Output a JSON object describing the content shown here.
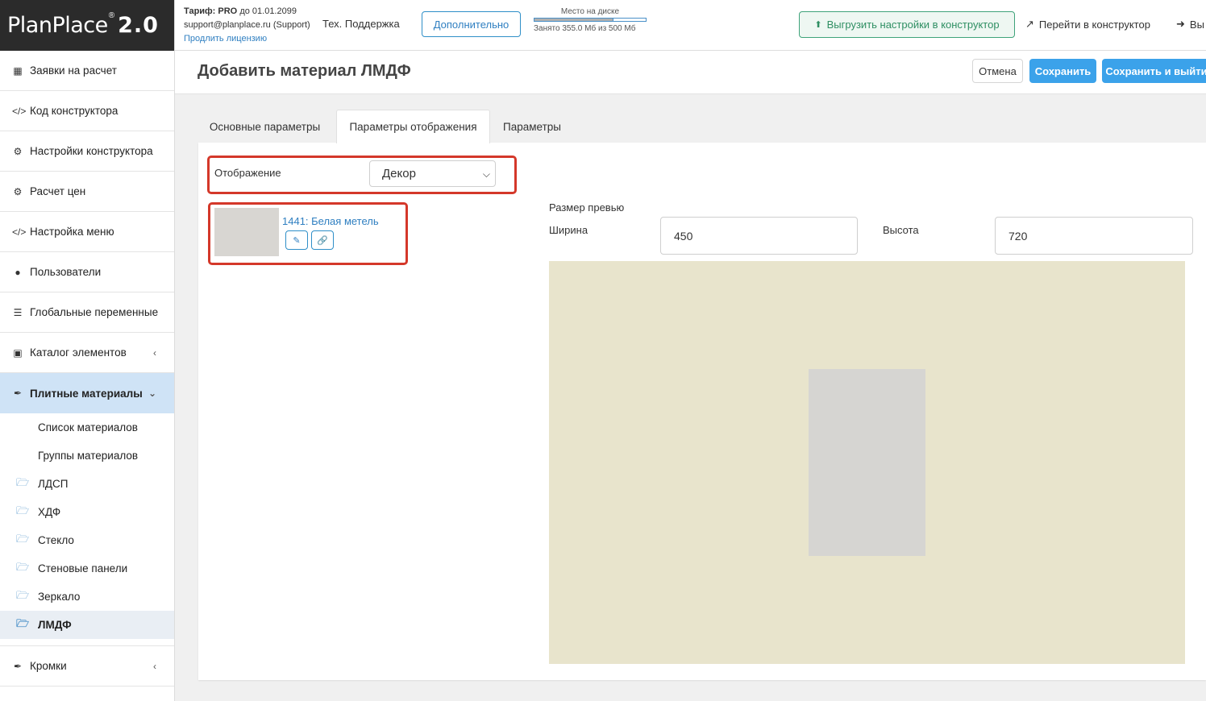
{
  "logo": {
    "brand": "PlanPlace",
    "reg": "®",
    "version": "2.0"
  },
  "license": {
    "tariff_label": "Тариф:",
    "tariff_plan": "PRO",
    "tariff_until": "до 01.01.2099",
    "email": "support@planplace.ru (Support)",
    "renew_link": "Продлить лицензию"
  },
  "topbar": {
    "support": "Тех. Поддержка",
    "more_button": "Дополнительно",
    "disk_label": "Место на диске",
    "disk_usage": "Занято 355.0 Мб из 500 Мб",
    "disk_fill_fraction": 0.71,
    "export_button": "Выгрузить настройки в конструктор",
    "go_constructor": "Перейти в конструктор",
    "exit": "Вы"
  },
  "sidebar": {
    "items": [
      {
        "label": "Заявки на расчет",
        "icon": "clipboard-icon"
      },
      {
        "label": "Код конструктора",
        "icon": "code-icon"
      },
      {
        "label": "Настройки конструктора",
        "icon": "gears-icon"
      },
      {
        "label": "Расчет цен",
        "icon": "gears-icon"
      },
      {
        "label": "Настройка меню",
        "icon": "code-icon"
      },
      {
        "label": "Пользователи",
        "icon": "user-icon"
      },
      {
        "label": "Глобальные переменные",
        "icon": "list-icon"
      },
      {
        "label": "Каталог элементов",
        "icon": "book-icon"
      },
      {
        "label": "Плитные материалы",
        "icon": "brush-icon"
      }
    ],
    "sub_items": [
      "Список материалов",
      "Группы материалов"
    ],
    "folders": [
      "ЛДСП",
      "ХДФ",
      "Стекло",
      "Стеновые панели",
      "Зеркало",
      "ЛМДФ"
    ],
    "bottom_item": "Кромки"
  },
  "page": {
    "title": "Добавить материал ЛМДФ",
    "cancel": "Отмена",
    "save": "Сохранить",
    "save_exit": "Сохранить и выйти"
  },
  "tabs": [
    "Основные параметры",
    "Параметры отображения",
    "Параметры"
  ],
  "display": {
    "label": "Отображение",
    "value": "Декор",
    "decor_link": "1441: Белая метель"
  },
  "preview": {
    "title": "Размер превью",
    "width_label": "Ширина",
    "width_value": "450",
    "height_label": "Высота",
    "height_value": "720"
  }
}
